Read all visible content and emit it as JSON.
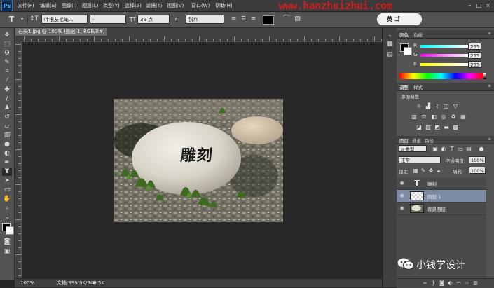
{
  "app": {
    "logo": "Ps"
  },
  "menu": [
    "文件(F)",
    "编辑(E)",
    "图像(I)",
    "图层(L)",
    "类型(Y)",
    "选择(S)",
    "滤镜(T)",
    "视图(V)",
    "窗口(W)",
    "帮助(H)"
  ],
  "watermark": "www.hanzhuizhui.com",
  "options_bar": {
    "tool_icon": "T",
    "font_family": "叶根友毛笔...",
    "font_style": "-",
    "font_size": "36 点",
    "aa_label": "a",
    "aa_mode": "锐利",
    "brand_badge": "英 ゴ"
  },
  "document": {
    "tab_title": "石头1.jpg @ 100% (图层 1, RGB/8#) *",
    "close": "×",
    "carved_text": "雕刻",
    "status_zoom": "100%",
    "status_doc": "文档:399.9K/948.5K"
  },
  "color_panel": {
    "tabs": [
      "颜色",
      "色板"
    ],
    "r_label": "R",
    "r_value": "255",
    "g_label": "G",
    "g_value": "255",
    "b_label": "B",
    "b_value": "255"
  },
  "adjust_panel": {
    "tabs": [
      "调整",
      "样式"
    ],
    "title": "添加调整"
  },
  "layers_panel": {
    "tabs": [
      "图层",
      "通道",
      "路径"
    ],
    "kind": "ρ 类型",
    "blend": "正常",
    "opacity_label": "不透明度:",
    "opacity": "100%",
    "lock_label": "锁定:",
    "fill_label": "填充:",
    "fill": "100%",
    "layers": [
      {
        "name": "雕刻",
        "kind": "text",
        "thumb": "T"
      },
      {
        "name": "图层 1",
        "kind": "pixel",
        "selected": true
      },
      {
        "name": "背景图层",
        "kind": "image"
      }
    ]
  },
  "wechat": {
    "text": "小钱学设计"
  },
  "colors": {
    "selected_layer": "#7b8ba4",
    "watermark": "#cc1f1f"
  }
}
